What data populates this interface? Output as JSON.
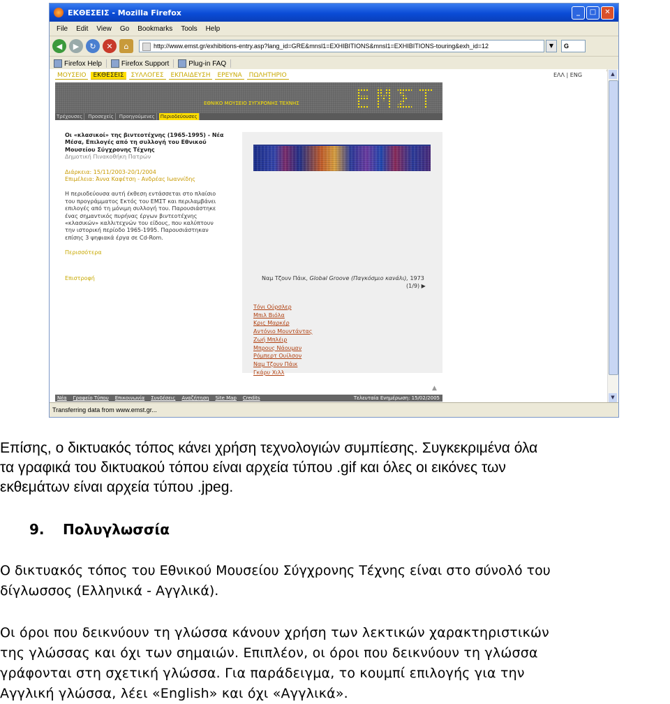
{
  "browser": {
    "window_title": "ΕΚΘΕΣΕΙΣ - Mozilla Firefox",
    "window_buttons": [
      "_",
      "□",
      "✕"
    ],
    "menu": [
      "File",
      "Edit",
      "View",
      "Go",
      "Bookmarks",
      "Tools",
      "Help"
    ],
    "url": "http://www.emst.gr/exhibitions-entry.asp?lang_id=GRE&mnsl1=EXHIBITIONS&mnsl1=EXHIBITIONS-touring&exh_id=12",
    "bookmarks": [
      "Firefox Help",
      "Firefox Support",
      "Plug-in FAQ"
    ],
    "status": "Transferring data from www.emst.gr..."
  },
  "site": {
    "top_nav": [
      "ΜΟΥΣΕΙΟ",
      "ΕΚΘΕΣΕΙΣ",
      "ΣΥΛΛΟΓΕΣ",
      "ΕΚΠΑΙΔΕΥΣΗ",
      "ΕΡΕΥΝΑ",
      "ΠΩΛΗΤΗΡΙΟ"
    ],
    "lang_switch": "ΕΛΛ | ENG",
    "banner_logo": "ΕΜΣΤ",
    "banner_subtitle": "ΕΘΝΙΚΟ ΜΟΥΣΕΙΟ ΣΥΓΧΡΟΝΗΣ ΤΕΧΝΗΣ",
    "sub_nav": [
      "Τρέχουσες",
      "Προσεχείς",
      "Προηγούμενες",
      "Περιοδεύουσες"
    ],
    "exhibition": {
      "title_lines": [
        "Οι «κλασικοί» της βιντεοτέχνης (1965-1995) - Νέα",
        "Μέσα, Επιλογές από τη συλλογή του Εθνικού",
        "Μουσείου Σύγχρονης Τέχνης"
      ],
      "venue": "Δημοτική Πινακοθήκη Πατρών",
      "duration": "Διάρκεια: 15/11/2003-20/1/2004",
      "curators": "Επιμέλεια: Άννα Καφέτση - Ανδρέας Ιωαννίδης",
      "desc_lines": [
        "Η περιοδεύουσα αυτή έκθεση εντάσσεται στο πλαίσιο",
        "του προγράμματος Εκτός του ΕΜΣΤ και περιλαμβάνει",
        "επιλογές από τη μόνιμη συλλογή του. Παρουσιάστηκε",
        "ένας σημαντικός πυρήνας έργων βιντεοτέχνης",
        "«κλασικών» καλλιτεχνών του είδους, που καλύπτουν",
        "την ιστορική περίοδο 1965-1995. Παρουσιάστηκαν",
        "επίσης 3 ψηφιακά έργα σε Cd-Rom."
      ],
      "more_link": "Περισσότερα",
      "back_link": "Επιστροφή"
    },
    "caption_artist": "Ναμ Τζουν Πάικ,",
    "caption_work": "Global Groove (Παγκόσμιο κανάλι),",
    "caption_year": "1973",
    "counter": "(1/9) ▶",
    "artists": [
      "Τόνι Ούρσλερ",
      "Μπιλ Βιόλα",
      "Κρις Μαρκέρ",
      "Αντόνιο Μουντάντας",
      "Ζωή Μπλέιρ",
      "Μπρους Νάουμαν",
      "Ρόμπερτ Ουίλσον",
      "Ναμ Τζουν Πάικ",
      "Γκάρυ Χιλλ"
    ],
    "footer_links": [
      "Νέα",
      "Γραφείο Τύπου",
      "Επικοινωνία",
      "Συνδέσεις",
      "Αναζήτηση",
      "Site Map",
      "Credits"
    ],
    "footer_update": "Τελευταία Ενημέρωση: 15/02/2005"
  },
  "document": {
    "paragraph1": [
      "Επίσης, ο δικτυακός τόπος κάνει χρήση τεχνολογιών συμπίεσης. Συγκεκριμένα όλα",
      "τα γραφικά του δικτυακού τόπου είναι αρχεία τύπου .gif και όλες οι εικόνες των",
      "εκθεμάτων είναι αρχεία τύπου .jpeg."
    ],
    "section_number": "9.",
    "section_title": "Πολυγλωσσία",
    "paragraph2": [
      "Ο δικτυακός τόπος του Εθνικού Μουσείου Σύγχρονης Τέχνης είναι στο σύνολό του",
      "δίγλωσσος (Ελληνικά - Αγγλικά)."
    ],
    "paragraph3": [
      "Οι όροι που δεικνύουν τη γλώσσα κάνουν χρήση των λεκτικών χαρακτηριστικών",
      "της γλώσσας και όχι των σημαιών. Επιπλέον, οι όροι που δεικνύουν τη γλώσσα",
      "γράφονται στη σχετική γλώσσα. Για παράδειγμα, το κουμπί επιλογής για την",
      "Αγγλική γλώσσα, λέει «English» και όχι «Αγγλικά»."
    ]
  }
}
